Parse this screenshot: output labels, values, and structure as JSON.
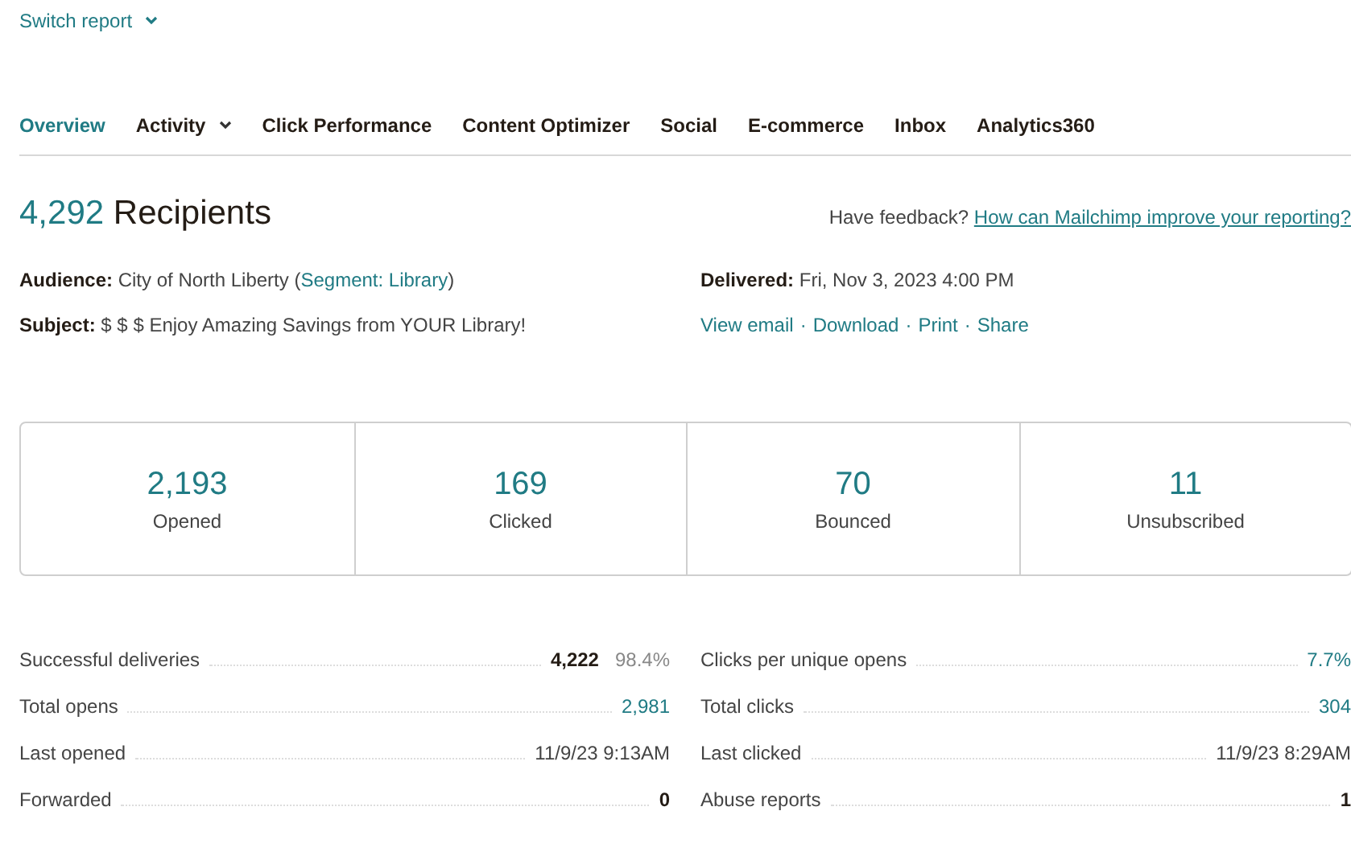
{
  "switch_report": {
    "label": "Switch report"
  },
  "tabs": [
    {
      "label": "Overview",
      "selected": true,
      "has_menu": false
    },
    {
      "label": "Activity",
      "selected": false,
      "has_menu": true
    },
    {
      "label": "Click Performance",
      "selected": false,
      "has_menu": false
    },
    {
      "label": "Content Optimizer",
      "selected": false,
      "has_menu": false
    },
    {
      "label": "Social",
      "selected": false,
      "has_menu": false
    },
    {
      "label": "E-commerce",
      "selected": false,
      "has_menu": false
    },
    {
      "label": "Inbox",
      "selected": false,
      "has_menu": false
    },
    {
      "label": "Analytics360",
      "selected": false,
      "has_menu": false
    }
  ],
  "heading": {
    "count": "4,292",
    "label": "Recipients"
  },
  "feedback": {
    "prompt": "Have feedback?",
    "link": "How can Mailchimp improve your reporting?"
  },
  "audience": {
    "label": "Audience:",
    "value": "City of North Liberty (",
    "link": "Segment: Library",
    "after": ")"
  },
  "subject": {
    "label": "Subject:",
    "value": "$ $ $ Enjoy Amazing Savings from YOUR Library!"
  },
  "delivered": {
    "label": "Delivered:",
    "value": "Fri, Nov 3, 2023 4:00 PM"
  },
  "actions": {
    "separator": "·",
    "links": [
      "View email",
      "Download",
      "Print",
      "Share"
    ]
  },
  "summary": [
    {
      "value": "2,193",
      "label": "Opened"
    },
    {
      "value": "169",
      "label": "Clicked"
    },
    {
      "value": "70",
      "label": "Bounced"
    },
    {
      "value": "11",
      "label": "Unsubscribed"
    }
  ],
  "stats_left": [
    {
      "label": "Successful deliveries",
      "value": "4,222",
      "kind": "bold",
      "percent": "98.4%"
    },
    {
      "label": "Total opens",
      "value": "2,981",
      "kind": "link"
    },
    {
      "label": "Last opened",
      "value": "11/9/23 9:13AM",
      "kind": "plain"
    },
    {
      "label": "Forwarded",
      "value": "0",
      "kind": "bold"
    }
  ],
  "stats_right": [
    {
      "label": "Clicks per unique opens",
      "value": "7.7%",
      "kind": "link"
    },
    {
      "label": "Total clicks",
      "value": "304",
      "kind": "link"
    },
    {
      "label": "Last clicked",
      "value": "11/9/23 8:29AM",
      "kind": "plain"
    },
    {
      "label": "Abuse reports",
      "value": "1",
      "kind": "bold"
    }
  ]
}
